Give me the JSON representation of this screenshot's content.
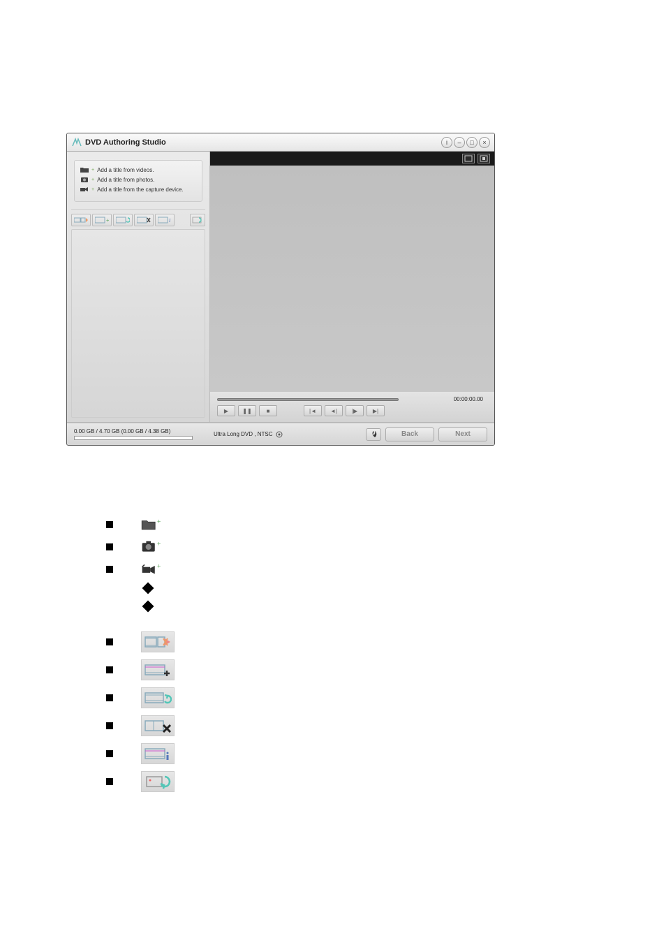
{
  "app": {
    "title": "DVD Authoring Studio"
  },
  "add_panel": {
    "item1": "Add a title from videos.",
    "item2": "Add a title from photos.",
    "item3": "Add a title from the capture device."
  },
  "preview": {
    "timecode": "00:00:00.00"
  },
  "footer": {
    "capacity": "0.00 GB / 4.70 GB (0.00 GB / 4.38 GB)",
    "format": "Ultra Long DVD , NTSC",
    "back": "Back",
    "next": "Next"
  }
}
